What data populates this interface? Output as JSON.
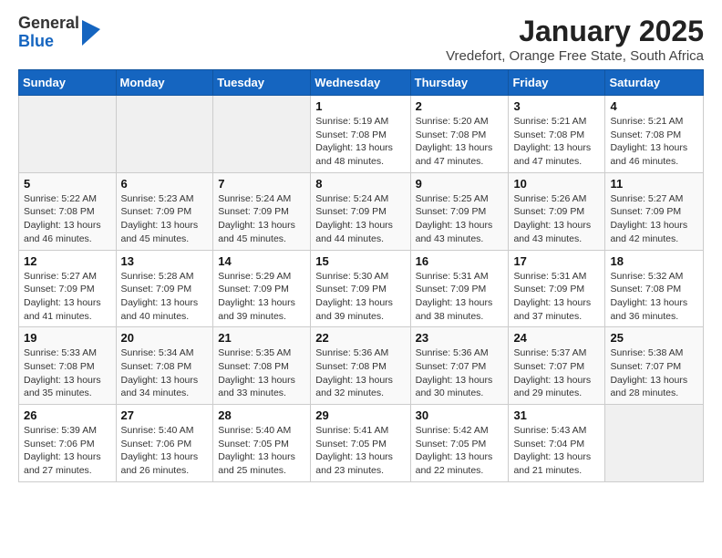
{
  "logo": {
    "general": "General",
    "blue": "Blue"
  },
  "header": {
    "month_year": "January 2025",
    "location": "Vredefort, Orange Free State, South Africa"
  },
  "weekdays": [
    "Sunday",
    "Monday",
    "Tuesday",
    "Wednesday",
    "Thursday",
    "Friday",
    "Saturday"
  ],
  "weeks": [
    [
      {
        "day": "",
        "sunrise": "",
        "sunset": "",
        "daylight": ""
      },
      {
        "day": "",
        "sunrise": "",
        "sunset": "",
        "daylight": ""
      },
      {
        "day": "",
        "sunrise": "",
        "sunset": "",
        "daylight": ""
      },
      {
        "day": "1",
        "sunrise": "Sunrise: 5:19 AM",
        "sunset": "Sunset: 7:08 PM",
        "daylight": "Daylight: 13 hours and 48 minutes."
      },
      {
        "day": "2",
        "sunrise": "Sunrise: 5:20 AM",
        "sunset": "Sunset: 7:08 PM",
        "daylight": "Daylight: 13 hours and 47 minutes."
      },
      {
        "day": "3",
        "sunrise": "Sunrise: 5:21 AM",
        "sunset": "Sunset: 7:08 PM",
        "daylight": "Daylight: 13 hours and 47 minutes."
      },
      {
        "day": "4",
        "sunrise": "Sunrise: 5:21 AM",
        "sunset": "Sunset: 7:08 PM",
        "daylight": "Daylight: 13 hours and 46 minutes."
      }
    ],
    [
      {
        "day": "5",
        "sunrise": "Sunrise: 5:22 AM",
        "sunset": "Sunset: 7:08 PM",
        "daylight": "Daylight: 13 hours and 46 minutes."
      },
      {
        "day": "6",
        "sunrise": "Sunrise: 5:23 AM",
        "sunset": "Sunset: 7:09 PM",
        "daylight": "Daylight: 13 hours and 45 minutes."
      },
      {
        "day": "7",
        "sunrise": "Sunrise: 5:24 AM",
        "sunset": "Sunset: 7:09 PM",
        "daylight": "Daylight: 13 hours and 45 minutes."
      },
      {
        "day": "8",
        "sunrise": "Sunrise: 5:24 AM",
        "sunset": "Sunset: 7:09 PM",
        "daylight": "Daylight: 13 hours and 44 minutes."
      },
      {
        "day": "9",
        "sunrise": "Sunrise: 5:25 AM",
        "sunset": "Sunset: 7:09 PM",
        "daylight": "Daylight: 13 hours and 43 minutes."
      },
      {
        "day": "10",
        "sunrise": "Sunrise: 5:26 AM",
        "sunset": "Sunset: 7:09 PM",
        "daylight": "Daylight: 13 hours and 43 minutes."
      },
      {
        "day": "11",
        "sunrise": "Sunrise: 5:27 AM",
        "sunset": "Sunset: 7:09 PM",
        "daylight": "Daylight: 13 hours and 42 minutes."
      }
    ],
    [
      {
        "day": "12",
        "sunrise": "Sunrise: 5:27 AM",
        "sunset": "Sunset: 7:09 PM",
        "daylight": "Daylight: 13 hours and 41 minutes."
      },
      {
        "day": "13",
        "sunrise": "Sunrise: 5:28 AM",
        "sunset": "Sunset: 7:09 PM",
        "daylight": "Daylight: 13 hours and 40 minutes."
      },
      {
        "day": "14",
        "sunrise": "Sunrise: 5:29 AM",
        "sunset": "Sunset: 7:09 PM",
        "daylight": "Daylight: 13 hours and 39 minutes."
      },
      {
        "day": "15",
        "sunrise": "Sunrise: 5:30 AM",
        "sunset": "Sunset: 7:09 PM",
        "daylight": "Daylight: 13 hours and 39 minutes."
      },
      {
        "day": "16",
        "sunrise": "Sunrise: 5:31 AM",
        "sunset": "Sunset: 7:09 PM",
        "daylight": "Daylight: 13 hours and 38 minutes."
      },
      {
        "day": "17",
        "sunrise": "Sunrise: 5:31 AM",
        "sunset": "Sunset: 7:09 PM",
        "daylight": "Daylight: 13 hours and 37 minutes."
      },
      {
        "day": "18",
        "sunrise": "Sunrise: 5:32 AM",
        "sunset": "Sunset: 7:08 PM",
        "daylight": "Daylight: 13 hours and 36 minutes."
      }
    ],
    [
      {
        "day": "19",
        "sunrise": "Sunrise: 5:33 AM",
        "sunset": "Sunset: 7:08 PM",
        "daylight": "Daylight: 13 hours and 35 minutes."
      },
      {
        "day": "20",
        "sunrise": "Sunrise: 5:34 AM",
        "sunset": "Sunset: 7:08 PM",
        "daylight": "Daylight: 13 hours and 34 minutes."
      },
      {
        "day": "21",
        "sunrise": "Sunrise: 5:35 AM",
        "sunset": "Sunset: 7:08 PM",
        "daylight": "Daylight: 13 hours and 33 minutes."
      },
      {
        "day": "22",
        "sunrise": "Sunrise: 5:36 AM",
        "sunset": "Sunset: 7:08 PM",
        "daylight": "Daylight: 13 hours and 32 minutes."
      },
      {
        "day": "23",
        "sunrise": "Sunrise: 5:36 AM",
        "sunset": "Sunset: 7:07 PM",
        "daylight": "Daylight: 13 hours and 30 minutes."
      },
      {
        "day": "24",
        "sunrise": "Sunrise: 5:37 AM",
        "sunset": "Sunset: 7:07 PM",
        "daylight": "Daylight: 13 hours and 29 minutes."
      },
      {
        "day": "25",
        "sunrise": "Sunrise: 5:38 AM",
        "sunset": "Sunset: 7:07 PM",
        "daylight": "Daylight: 13 hours and 28 minutes."
      }
    ],
    [
      {
        "day": "26",
        "sunrise": "Sunrise: 5:39 AM",
        "sunset": "Sunset: 7:06 PM",
        "daylight": "Daylight: 13 hours and 27 minutes."
      },
      {
        "day": "27",
        "sunrise": "Sunrise: 5:40 AM",
        "sunset": "Sunset: 7:06 PM",
        "daylight": "Daylight: 13 hours and 26 minutes."
      },
      {
        "day": "28",
        "sunrise": "Sunrise: 5:40 AM",
        "sunset": "Sunset: 7:05 PM",
        "daylight": "Daylight: 13 hours and 25 minutes."
      },
      {
        "day": "29",
        "sunrise": "Sunrise: 5:41 AM",
        "sunset": "Sunset: 7:05 PM",
        "daylight": "Daylight: 13 hours and 23 minutes."
      },
      {
        "day": "30",
        "sunrise": "Sunrise: 5:42 AM",
        "sunset": "Sunset: 7:05 PM",
        "daylight": "Daylight: 13 hours and 22 minutes."
      },
      {
        "day": "31",
        "sunrise": "Sunrise: 5:43 AM",
        "sunset": "Sunset: 7:04 PM",
        "daylight": "Daylight: 13 hours and 21 minutes."
      },
      {
        "day": "",
        "sunrise": "",
        "sunset": "",
        "daylight": ""
      }
    ]
  ]
}
